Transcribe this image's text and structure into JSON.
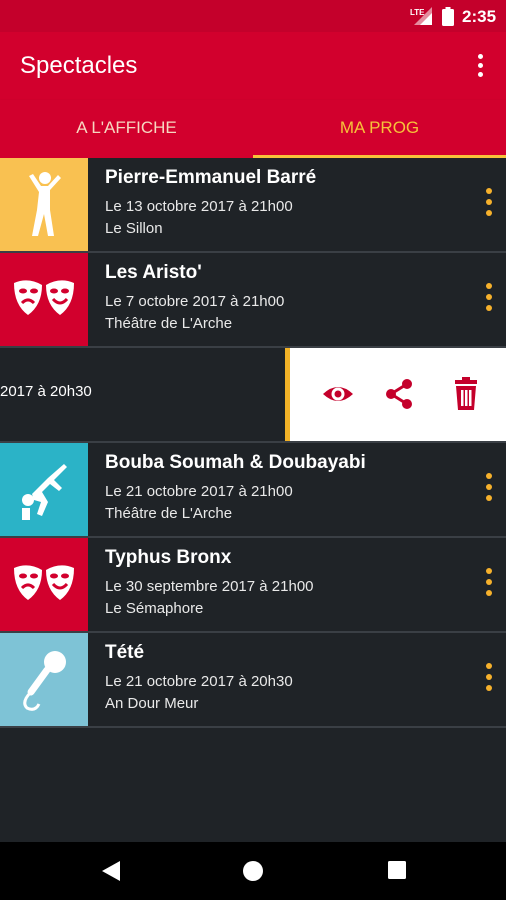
{
  "status": {
    "network": "LTE",
    "time": "2:35"
  },
  "appbar": {
    "title": "Spectacles",
    "menu_icon": "more-vert-icon"
  },
  "tabs": [
    {
      "label": "A L'AFFICHE",
      "selected": false
    },
    {
      "label": "MA PROG",
      "selected": true
    }
  ],
  "colors": {
    "primary": "#d2002d",
    "accent": "#f6c23a",
    "list_bg": "#1f2327"
  },
  "shows": [
    {
      "name": "Pierre-Emmanuel Barré",
      "date": "Le 13 octobre 2017 à 21h00",
      "venue": "Le Sillon",
      "icon": "dancer-icon",
      "color": "#f9c151"
    },
    {
      "name": "Les Aristo'",
      "date": "Le 7 octobre 2017 à 21h00",
      "venue": "Théâtre de L'Arche",
      "icon": "theater-masks-icon",
      "color": "#d2002d"
    },
    {
      "name": "Bouba Soumah & Doubayabi",
      "date": "Le 21 octobre 2017 à 21h00",
      "venue": "Théâtre de L'Arche",
      "icon": "breakdancer-icon",
      "color": "#2bb3c7"
    },
    {
      "name": "Typhus Bronx",
      "date": "Le 30 septembre 2017 à 21h00",
      "venue": "Le Sémaphore",
      "icon": "theater-masks-icon",
      "color": "#d2002d"
    },
    {
      "name": "Tété",
      "date": "Le 21 octobre 2017 à 20h30",
      "venue": "An Dour Meur",
      "icon": "microphone-icon",
      "color": "#7ec3d6"
    }
  ],
  "swiped_row": {
    "partial_date": "2017 à 20h30",
    "actions": [
      {
        "icon": "eye-icon",
        "label": "view"
      },
      {
        "icon": "share-icon",
        "label": "share"
      },
      {
        "icon": "trash-icon",
        "label": "delete"
      }
    ]
  },
  "navbar": {
    "back": "back-icon",
    "home": "home-icon",
    "recents": "recents-icon"
  }
}
